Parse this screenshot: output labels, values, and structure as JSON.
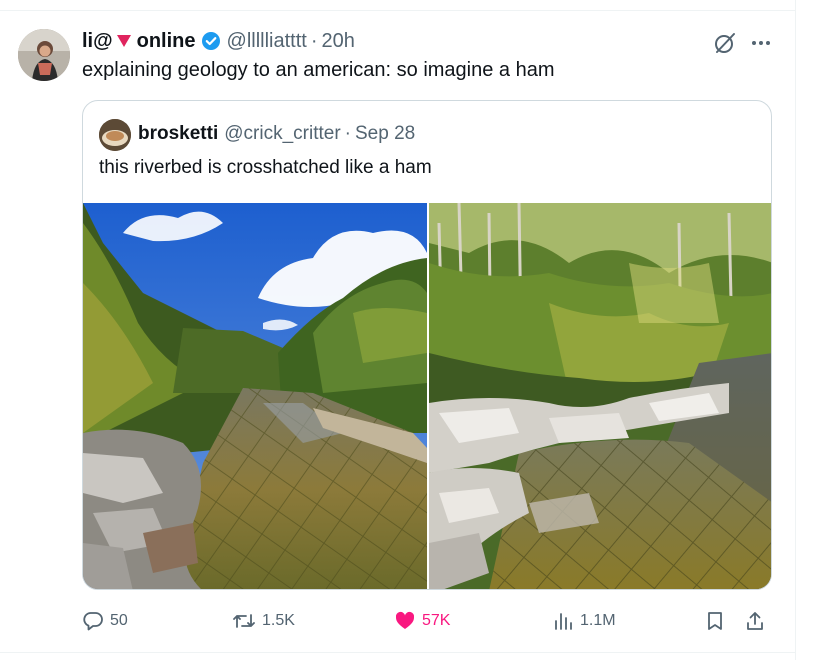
{
  "tweet": {
    "display_name": "li@",
    "display_name_suffix": "online",
    "handle": "@llllliatttt",
    "separator": "·",
    "time": "20h",
    "text": "explaining geology to an american: so imagine a ham"
  },
  "quoted": {
    "display_name": "brosketti",
    "handle": "@crick_critter",
    "separator": "·",
    "date": "Sep 28",
    "text": "this riverbed is crosshatched like a ham"
  },
  "actions": {
    "replies": "50",
    "reposts": "1.5K",
    "likes": "57K",
    "views": "1.1M"
  },
  "colors": {
    "accent_like": "#f91880",
    "verified": "#1d9bf0",
    "muted": "#536471"
  },
  "icons": [
    "grok-icon",
    "more-icon",
    "reply-icon",
    "retweet-icon",
    "heart-icon",
    "views-icon",
    "bookmark-icon",
    "share-icon",
    "verified-icon",
    "red-heart-emoji"
  ]
}
